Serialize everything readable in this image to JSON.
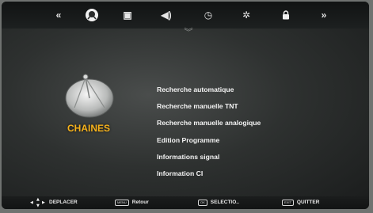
{
  "top_bar": {
    "icons": [
      {
        "name": "rewind-icon",
        "glyph": "«"
      },
      {
        "name": "channels-dish-icon",
        "glyph": ""
      },
      {
        "name": "picture-icon",
        "glyph": "▣"
      },
      {
        "name": "sound-icon",
        "glyph": "◀)"
      },
      {
        "name": "clock-icon",
        "glyph": "◷"
      },
      {
        "name": "settings-gear-icon",
        "glyph": "✲"
      },
      {
        "name": "lock-icon",
        "glyph": "🔒"
      },
      {
        "name": "forward-icon",
        "glyph": "»"
      }
    ]
  },
  "category": {
    "label": "CHAINES",
    "accent_color": "#f7b21b"
  },
  "menu": {
    "items": [
      "Recherche automatique",
      "Recherche manuelle TNT",
      "Recherche manuelle analogique",
      "Edition Programme",
      "Informations signal",
      "Information CI"
    ]
  },
  "bottom_bar": {
    "move_label": "DEPLACER",
    "back_key": "MENU",
    "back_label": "Retour",
    "select_key": "OK",
    "select_label": "SELECTIO..",
    "exit_key": "EXIT",
    "exit_label": "QUITTER"
  }
}
